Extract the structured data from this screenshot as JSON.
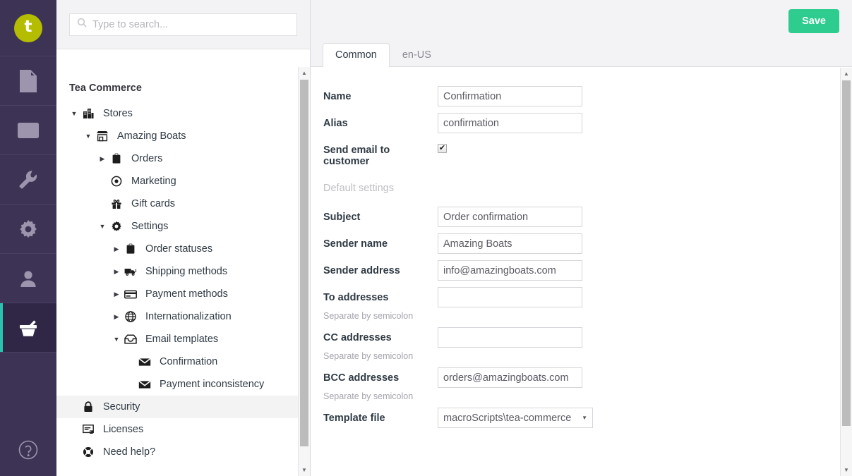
{
  "colors": {
    "rail_bg": "#3d3455",
    "rail_active_bg": "#2f2745",
    "rail_accent": "#29c3b0",
    "logo_bg": "#b5bd00",
    "save_green": "#2ecc8f",
    "header_bg": "#f3f3f5",
    "selected_row": "#f3f3f4"
  },
  "rail": {
    "logo_letter": "t",
    "items": [
      {
        "icon": "document-icon",
        "name": "content"
      },
      {
        "icon": "media-icon",
        "name": "media"
      },
      {
        "icon": "wrench-icon",
        "name": "settings"
      },
      {
        "icon": "gear-icon",
        "name": "developer"
      },
      {
        "icon": "user-icon",
        "name": "users"
      },
      {
        "icon": "basket-icon",
        "name": "commerce"
      }
    ],
    "help_icon": "help-lifebuoy-icon"
  },
  "search": {
    "placeholder": "Type to search...",
    "value": "",
    "icon": "search-icon"
  },
  "tree": {
    "title": "Tea Commerce",
    "nodes": [
      {
        "label": "Stores",
        "icon": "buildings-icon",
        "indent": 0,
        "caret": "down",
        "selected": false
      },
      {
        "label": "Amazing Boats",
        "icon": "store-icon",
        "indent": 1,
        "caret": "down",
        "selected": false
      },
      {
        "label": "Orders",
        "icon": "clipboard-icon",
        "indent": 2,
        "caret": "right",
        "selected": false
      },
      {
        "label": "Marketing",
        "icon": "target-icon",
        "indent": 2,
        "caret": "none",
        "selected": false
      },
      {
        "label": "Gift cards",
        "icon": "gift-icon",
        "indent": 2,
        "caret": "none",
        "selected": false
      },
      {
        "label": "Settings",
        "icon": "gear-icon",
        "indent": 2,
        "caret": "down",
        "selected": false
      },
      {
        "label": "Order statuses",
        "icon": "clipboard-icon",
        "indent": 3,
        "caret": "right",
        "selected": false
      },
      {
        "label": "Shipping methods",
        "icon": "truck-icon",
        "indent": 3,
        "caret": "right",
        "selected": false
      },
      {
        "label": "Payment methods",
        "icon": "card-icon",
        "indent": 3,
        "caret": "right",
        "selected": false
      },
      {
        "label": "Internationalization",
        "icon": "globe-icon",
        "indent": 3,
        "caret": "right",
        "selected": false
      },
      {
        "label": "Email templates",
        "icon": "inbox-icon",
        "indent": 3,
        "caret": "down",
        "selected": false
      },
      {
        "label": "Confirmation",
        "icon": "envelope-icon",
        "indent": 4,
        "caret": "none",
        "selected": false
      },
      {
        "label": "Payment inconsistency",
        "icon": "envelope-icon",
        "indent": 4,
        "caret": "none",
        "selected": false
      },
      {
        "label": "Security",
        "icon": "lock-icon",
        "indent": 0,
        "caret": "none",
        "selected": true
      },
      {
        "label": "Licenses",
        "icon": "license-icon",
        "indent": 0,
        "caret": "none",
        "selected": false
      },
      {
        "label": "Need help?",
        "icon": "lifebuoy-icon",
        "indent": 0,
        "caret": "none",
        "selected": false
      }
    ],
    "scroll_up": "▲",
    "scroll_down": "▼"
  },
  "main": {
    "save_label": "Save",
    "tabs": [
      {
        "label": "Common",
        "active": true
      },
      {
        "label": "en-US",
        "active": false
      }
    ],
    "section_label": "Default settings",
    "hint_semicolon": "Separate by semicolon",
    "dropdown_caret": "▼",
    "checkbox_mark": "✔",
    "fields": {
      "name": {
        "label": "Name",
        "value": "Confirmation"
      },
      "alias": {
        "label": "Alias",
        "value": "confirmation"
      },
      "send_email": {
        "label": "Send email to customer",
        "checked": true
      },
      "subject": {
        "label": "Subject",
        "value": "Order confirmation"
      },
      "sender_name": {
        "label": "Sender name",
        "value": "Amazing Boats"
      },
      "sender_address": {
        "label": "Sender address",
        "value": "info@amazingboats.com"
      },
      "to_addresses": {
        "label": "To addresses",
        "value": ""
      },
      "cc_addresses": {
        "label": "CC addresses",
        "value": ""
      },
      "bcc_addresses": {
        "label": "BCC addresses",
        "value": "orders@amazingboats.com"
      },
      "template_file": {
        "label": "Template file",
        "value": "macroScripts\\tea-commerce"
      }
    },
    "scroll_up": "▲",
    "scroll_down": "▼"
  }
}
